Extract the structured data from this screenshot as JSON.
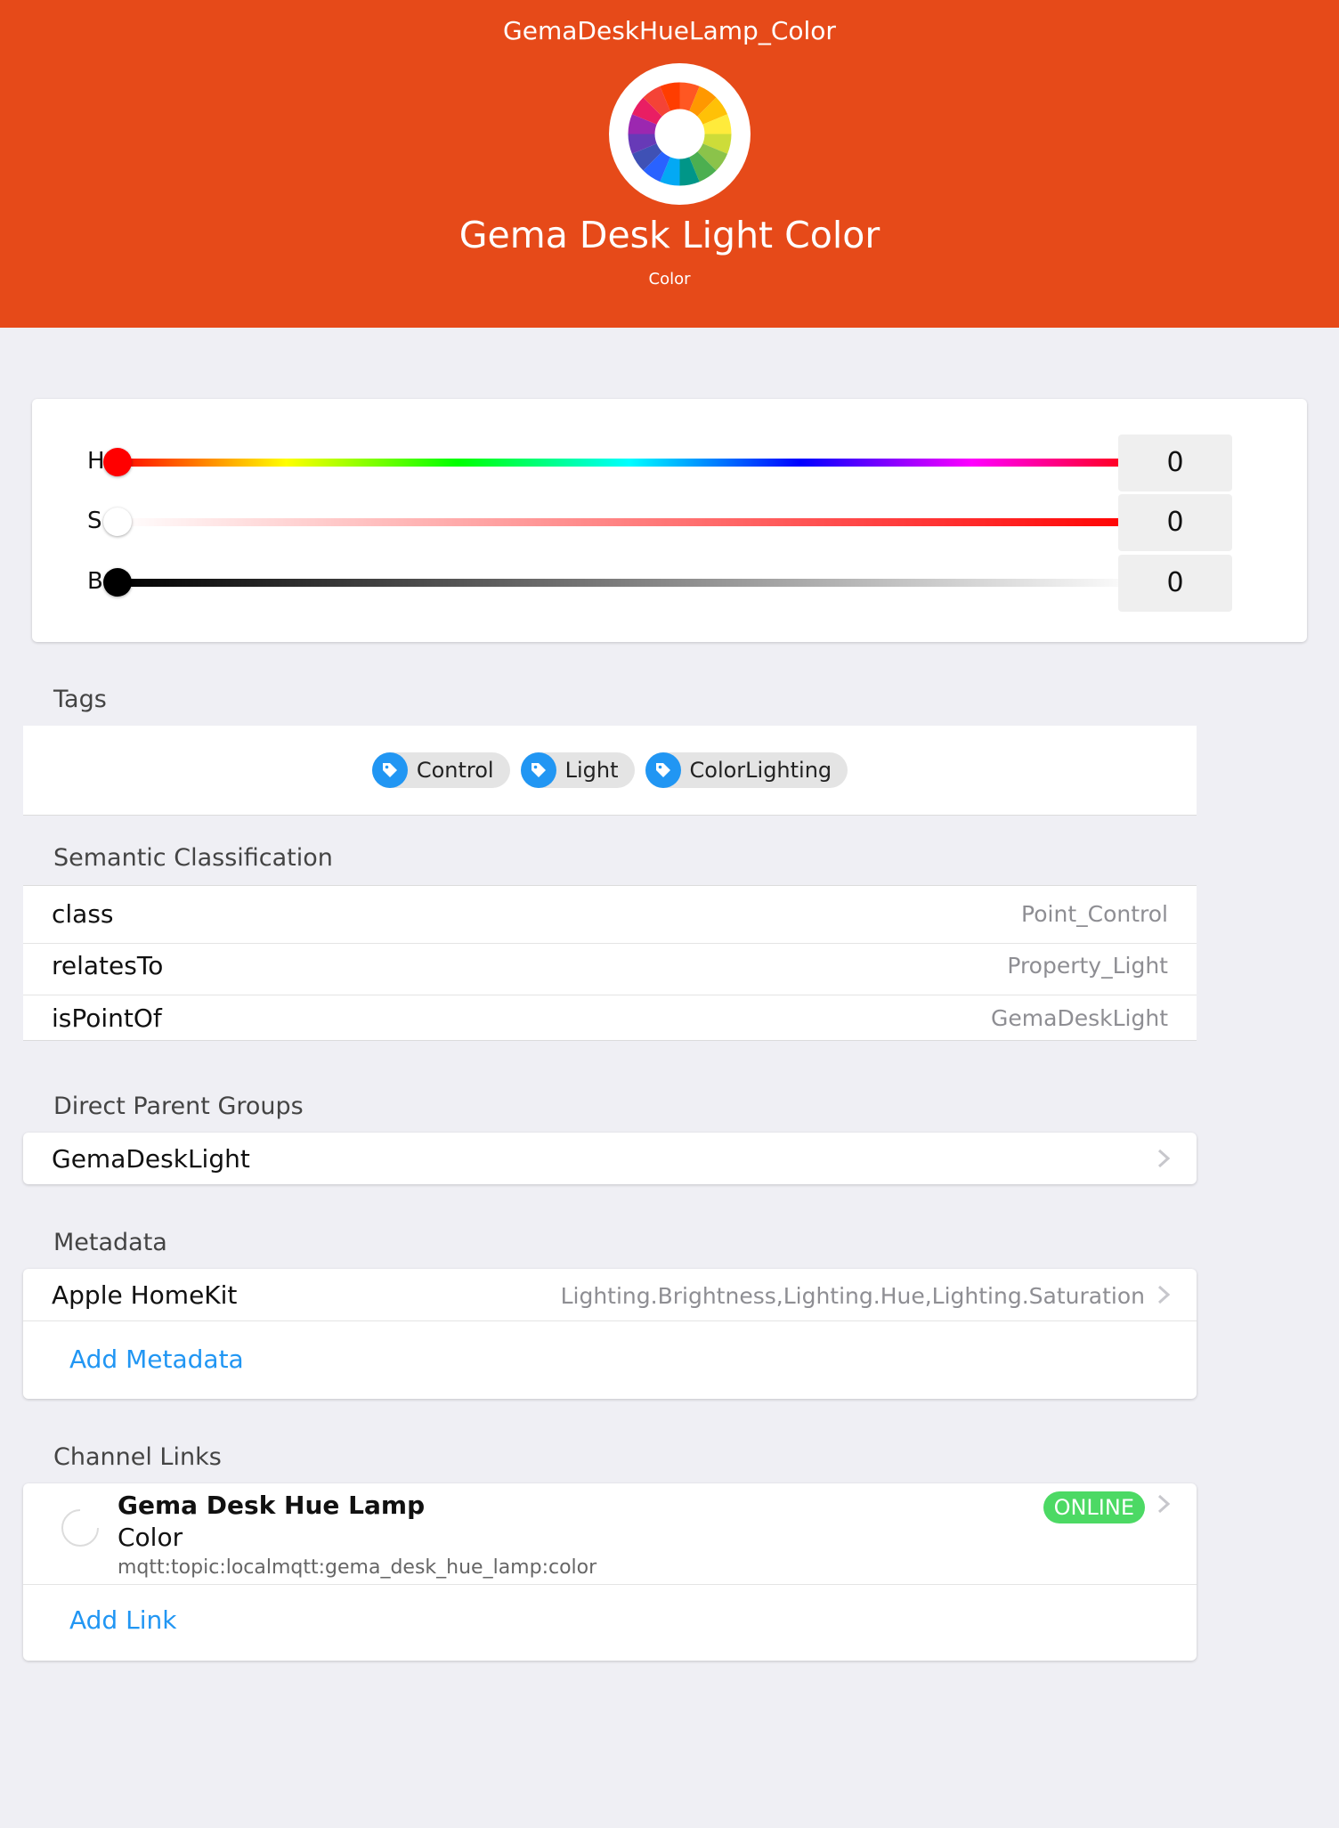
{
  "header": {
    "item_name": "GemaDeskHueLamp_Color",
    "label": "Gema Desk Light Color",
    "category": "Color",
    "icon": "color-wheel-icon",
    "background_color": "#e64a19"
  },
  "color_control": {
    "sliders": [
      {
        "letter": "H",
        "value": "0",
        "level": 0
      },
      {
        "letter": "S",
        "value": "0",
        "level": 0
      },
      {
        "letter": "B",
        "value": "0",
        "level": 0
      }
    ]
  },
  "tags": {
    "title": "Tags",
    "items": [
      "Control",
      "Light",
      "ColorLighting"
    ],
    "icon": "tag-icon"
  },
  "semantic": {
    "title": "Semantic Classification",
    "rows": [
      {
        "key": "class",
        "value": "Point_Control"
      },
      {
        "key": "relatesTo",
        "value": "Property_Light"
      },
      {
        "key": "isPointOf",
        "value": "GemaDeskLight"
      }
    ]
  },
  "parent_groups": {
    "title": "Direct Parent Groups",
    "items": [
      "GemaDeskLight"
    ]
  },
  "metadata": {
    "title": "Metadata",
    "rows": [
      {
        "key": "Apple HomeKit",
        "value": "Lighting.Brightness,Lighting.Hue,Lighting.Saturation"
      }
    ],
    "add_label": "Add Metadata"
  },
  "channel_links": {
    "title": "Channel Links",
    "items": [
      {
        "thing": "Gema Desk Hue Lamp",
        "channel": "Color",
        "uid": "mqtt:topic:localmqtt:gema_desk_hue_lamp:color",
        "status": "ONLINE"
      }
    ],
    "add_label": "Add Link"
  },
  "colors": {
    "accent": "#2196f3",
    "online": "#4cd964",
    "page_bg": "#efeff4"
  }
}
